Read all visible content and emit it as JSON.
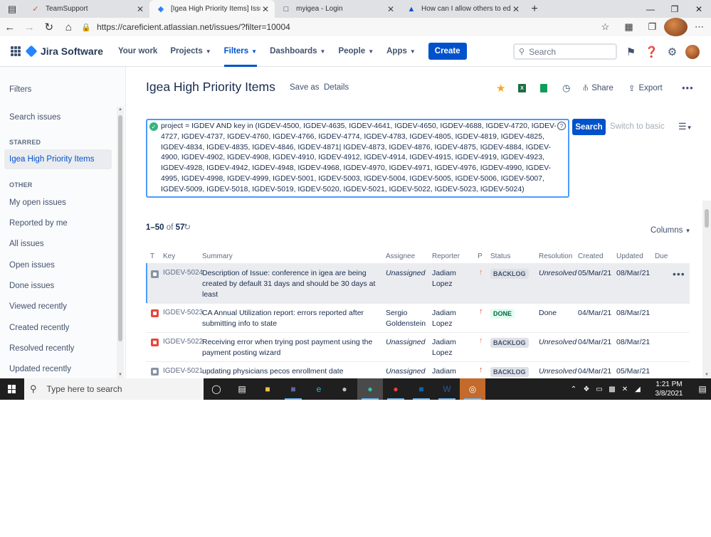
{
  "browser": {
    "tabs": [
      {
        "title": "TeamSupport",
        "icon": "teamsupport-icon"
      },
      {
        "title": "[Igea High Priority Items] Issue n",
        "icon": "jira-icon",
        "active": true
      },
      {
        "title": "myigea - Login",
        "icon": "page-icon"
      },
      {
        "title": "How can I allow others to edit m",
        "icon": "atlassian-icon"
      }
    ],
    "url": "https://careficient.atlassian.net/issues/?filter=10004"
  },
  "jira_nav": {
    "product": "Jira Software",
    "items": [
      {
        "label": "Your work",
        "chevron": false
      },
      {
        "label": "Projects",
        "chevron": true
      },
      {
        "label": "Filters",
        "chevron": true,
        "active": true
      },
      {
        "label": "Dashboards",
        "chevron": true
      },
      {
        "label": "People",
        "chevron": true
      },
      {
        "label": "Apps",
        "chevron": true
      }
    ],
    "create_label": "Create",
    "search_placeholder": "Search"
  },
  "sidebar": {
    "title": "Filters",
    "search_issues": "Search issues",
    "starred_heading": "STARRED",
    "starred_item": "Igea High Priority Items",
    "other_heading": "OTHER",
    "other_items": [
      "My open issues",
      "Reported by me",
      "All issues",
      "Open issues",
      "Done issues",
      "Viewed recently",
      "Created recently",
      "Resolved recently",
      "Updated recently"
    ]
  },
  "page": {
    "title": "Igea High Priority Items",
    "save_as": "Save as",
    "details": "Details",
    "share": "Share",
    "export": "Export"
  },
  "jql": {
    "query": "project = IGDEV AND key in (IGDEV-4500, IGDEV-4635, IGDEV-4641, IGDEV-4650, IGDEV-4688, IGDEV-4720, IGDEV-4727, IGDEV-4737, IGDEV-4760, IGDEV-4766, IGDEV-4774, IGDEV-4783, IGDEV-4805, IGDEV-4819, IGDEV-4825, IGDEV-4834, IGDEV-4835, IGDEV-4846, IGDEV-4871| IGDEV-4873, IGDEV-4876, IGDEV-4875, IGDEV-4884, IGDEV-4900, IGDEV-4902, IGDEV-4908, IGDEV-4910, IGDEV-4912, IGDEV-4914, IGDEV-4915, IGDEV-4919, IGDEV-4923, IGDEV-4928, IGDEV-4942, IGDEV-4948, IGDEV-4968, IGDEV-4970, IGDEV-4971, IGDEV-4976, IGDEV-4990, IGDEV-4995, IGDEV-4998, IGDEV-4999, IGDEV-5001, IGDEV-5003, IGDEV-5004, IGDEV-5005, IGDEV-5006, IGDEV-5007, IGDEV-5009, IGDEV-5018, IGDEV-5019, IGDEV-5020, IGDEV-5021, IGDEV-5022, IGDEV-5023, IGDEV-5024)",
    "search_label": "Search",
    "switch_label": "Switch to basic"
  },
  "results": {
    "range": "1–50",
    "of": "of",
    "total": "57",
    "columns_label": "Columns"
  },
  "table": {
    "headers": {
      "t": "T",
      "key": "Key",
      "summary": "Summary",
      "assignee": "Assignee",
      "reporter": "Reporter",
      "p": "P",
      "status": "Status",
      "resolution": "Resolution",
      "created": "Created",
      "updated": "Updated",
      "due": "Due"
    },
    "rows": [
      {
        "type": "task",
        "key": "IGDEV-5024",
        "summary": [
          "Description of Issue: conference in igea are being",
          "created by default 31 days and should be 30 days at",
          "least"
        ],
        "assignee": [
          "Unassigned"
        ],
        "reporter": [
          "Jadiam",
          "Lopez"
        ],
        "priority": "high",
        "status": "BACKLOG",
        "resolution": "Unresolved",
        "created": "05/Mar/21",
        "updated": "08/Mar/21"
      },
      {
        "type": "bug",
        "key": "IGDEV-5023",
        "summary": [
          "CA Annual Utilization report: errors reported after",
          "submitting info to state"
        ],
        "assignee": [
          "Sergio",
          "Goldenstein"
        ],
        "reporter": [
          "Jadiam",
          "Lopez"
        ],
        "priority": "highest",
        "status": "DONE",
        "resolution": "Done",
        "created": "04/Mar/21",
        "updated": "08/Mar/21"
      },
      {
        "type": "bug",
        "key": "IGDEV-5022",
        "summary": [
          "Receiving error when trying post payment using the",
          "payment posting wizard"
        ],
        "assignee": [
          "Unassigned"
        ],
        "reporter": [
          "Jadiam",
          "Lopez"
        ],
        "priority": "high",
        "status": "BACKLOG",
        "resolution": "Unresolved",
        "created": "04/Mar/21",
        "updated": "08/Mar/21"
      },
      {
        "type": "task",
        "key": "IGDEV-5021",
        "summary": [
          "updating physicians pecos enrollment date"
        ],
        "assignee": [
          "Unassigned"
        ],
        "reporter": [
          "Jadiam"
        ],
        "priority": "highest",
        "status": "BACKLOG",
        "resolution": "Unresolved",
        "created": "04/Mar/21",
        "updated": "05/Mar/21"
      }
    ]
  },
  "taskbar": {
    "search_placeholder": "Type here to search",
    "time": "1:21 PM",
    "date": "3/8/2021"
  },
  "colors": {
    "accent": "#0052cc",
    "prio_high": "#ff7452",
    "prio_highest": "#e5493a"
  }
}
